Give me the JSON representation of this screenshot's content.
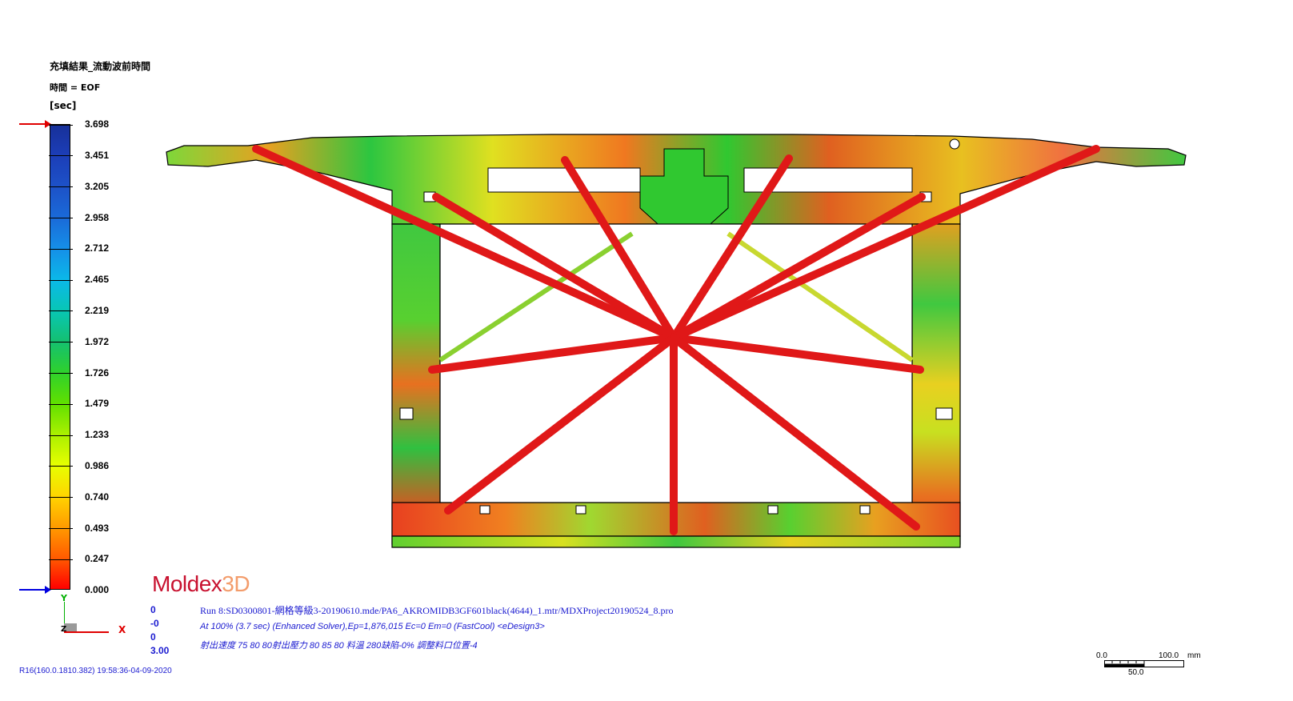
{
  "legend": {
    "title": "充填結果_流動波前時間",
    "subtitle": "時間 = EOF",
    "unit": "[sec]",
    "values": [
      "3.698",
      "3.451",
      "3.205",
      "2.958",
      "2.712",
      "2.465",
      "2.219",
      "1.972",
      "1.726",
      "1.479",
      "1.233",
      "0.986",
      "0.740",
      "0.493",
      "0.247",
      "0.000"
    ]
  },
  "logo": {
    "main": "Moldex",
    "suffix": "3D"
  },
  "info": {
    "nums": [
      "0",
      "-0",
      "0",
      "3.00"
    ],
    "line1": "Run 8:SD0300801-網格等級3-20190610.mde/PA6_AKROMIDB3GF601black(4644)_1.mtr/MDXProject20190524_8.pro",
    "line2": "At 100% (3.7 sec) (Enhanced Solver),Ep=1,876,015 Ec=0 Em=0 (FastCool) <eDesign3>",
    "line3": "射出速度 75 80 80射出壓力 80 85 80 料溫 280缺陷-0% 調整料口位置-4"
  },
  "axes": {
    "y": "Y",
    "x": "X",
    "z": "Z"
  },
  "footer": "R16(160.0.1810.382) 19:58:36-04-09-2020",
  "scale": {
    "start": "0.0",
    "end": "100.0",
    "unit": "mm",
    "mid": "50.0"
  },
  "colors": {
    "runner": "#e01818",
    "min": "#ff0000",
    "max": "#173099"
  }
}
